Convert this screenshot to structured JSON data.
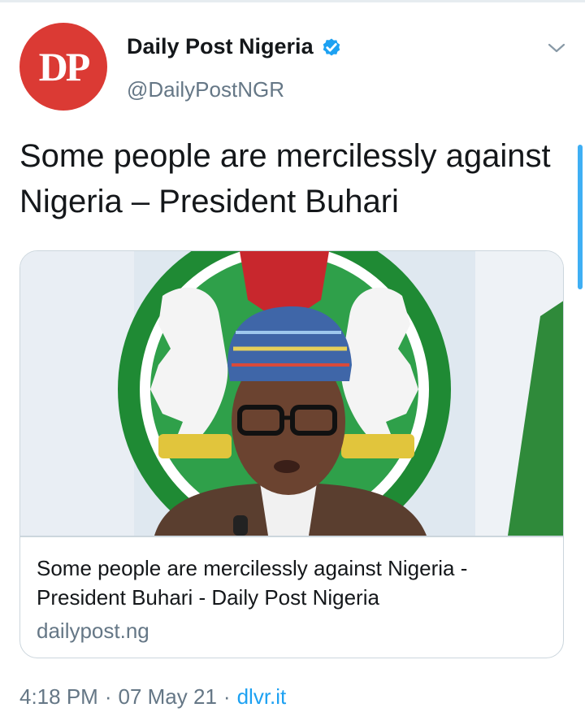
{
  "account": {
    "avatar_text": "DP",
    "display_name": "Daily Post Nigeria",
    "handle": "@DailyPostNGR",
    "verified_icon": "verified-badge-icon",
    "menu_icon": "chevron-down-icon"
  },
  "tweet": {
    "text": "Some people are mercilessly against Nigeria – President Buhari"
  },
  "card": {
    "image_icon": "article-photo",
    "title": "Some people are mercilessly against Nigeria - President Buhari - Daily Post Nigeria",
    "domain": "dailypost.ng"
  },
  "meta": {
    "time": "4:18 PM",
    "separator": "·",
    "date": "07 May 21",
    "source": "dlvr.it"
  },
  "colors": {
    "brand_red": "#db3a34",
    "link_blue": "#1da1f2",
    "secondary_text": "#657786",
    "primary_text": "#14171a"
  }
}
